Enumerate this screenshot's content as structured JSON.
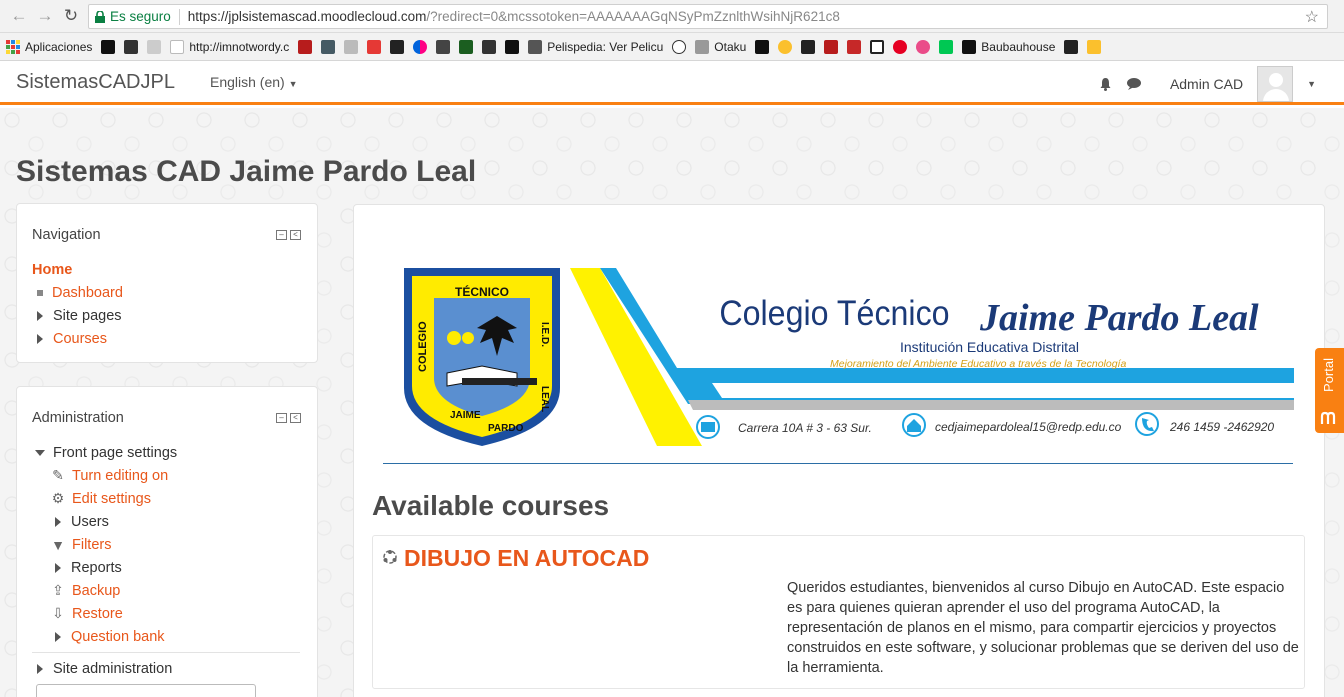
{
  "browser": {
    "secure_label": "Es seguro",
    "url_main": "https://jplsistemascad.moodlecloud.com",
    "url_rest": "/?redirect=0&mcssotoken=AAAAAAAGqNSyPmZznlthWsihNjR621c8",
    "bookmarks": [
      {
        "label": "Aplicaciones",
        "icon": "apps-grid-icon"
      },
      {
        "label": "",
        "icon": "bookmark-icon"
      },
      {
        "label": "",
        "icon": "bookmark-icon"
      },
      {
        "label": "",
        "icon": "bookmark-icon"
      },
      {
        "label": "http://imnotwordy.c",
        "icon": "page-icon"
      },
      {
        "label": "Pelispedia: Ver Pelicu",
        "icon": "film-icon"
      },
      {
        "label": "Otaku",
        "icon": "page-icon"
      },
      {
        "label": "Baubauhouse",
        "icon": "page-icon"
      }
    ]
  },
  "navbar": {
    "brand": "SistemasCADJPL",
    "language": "English (en)",
    "user_name": "Admin CAD"
  },
  "page": {
    "title": "Sistemas CAD Jaime Pardo Leal"
  },
  "navigation_block": {
    "title": "Navigation",
    "home": "Home",
    "dashboard": "Dashboard",
    "site_pages": "Site pages",
    "courses": "Courses"
  },
  "administration_block": {
    "title": "Administration",
    "front_page_settings": "Front page settings",
    "turn_editing_on": "Turn editing on",
    "edit_settings": "Edit settings",
    "users": "Users",
    "filters": "Filters",
    "reports": "Reports",
    "backup": "Backup",
    "restore": "Restore",
    "question_bank": "Question bank",
    "site_administration": "Site administration"
  },
  "banner": {
    "school_top": "TÉCNICO",
    "school_left": "COLEGIO",
    "school_right": "I.E.D.",
    "school_bottom_left": "JAIME",
    "school_bottom_right": "PARDO",
    "school_side": "LEAL",
    "title_plain": "Colegio Técnico",
    "title_script": "Jaime Pardo Leal",
    "subtitle": "Institución Educativa Distrital",
    "tagline": "Mejoramiento  del Ambiente Educativo a través de la Tecnología",
    "address": "Carrera 10A # 3 - 63 Sur.",
    "email": "cedjaimepardoleal15@redp.edu.co",
    "phone": "246 1459 -2462920"
  },
  "courses": {
    "heading": "Available courses",
    "items": [
      {
        "name": "DIBUJO EN AUTOCAD",
        "summary": "Queridos estudiantes, bienvenidos al curso Dibujo en AutoCAD. Este espacio es para quienes quieran aprender el uso del programa AutoCAD, la representación de planos en el mismo, para compartir ejercicios y proyectos construidos en este software, y solucionar problemas que se deriven del uso de la herramienta."
      }
    ]
  },
  "portal_tab": "Portal",
  "colors": {
    "accent": "#f98012",
    "link": "#e8571b",
    "banner_blue": "#1ea3e0",
    "banner_yellow": "#fff200"
  }
}
